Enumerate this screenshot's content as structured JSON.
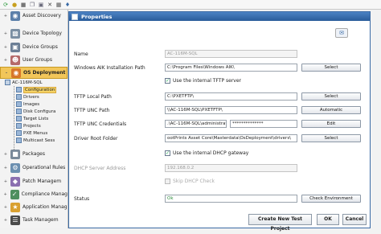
{
  "toolbar": {
    "icons": [
      "refresh-icon",
      "user-icon",
      "lock-icon",
      "copy-icon",
      "paste-icon",
      "delete-icon",
      "grid-icon",
      "share-icon"
    ]
  },
  "sidebar": {
    "items": [
      {
        "label": "Asset Discovery",
        "icon": "binoculars-icon",
        "color": "#5b7fa9"
      },
      {
        "label": "Device Topology",
        "icon": "topology-icon",
        "color": "#7b8fa3"
      },
      {
        "label": "Device Groups",
        "icon": "computers-icon",
        "color": "#6c7f96"
      },
      {
        "label": "User Groups",
        "icon": "users-icon",
        "color": "#b56a6a"
      },
      {
        "label": "OS Deployment",
        "icon": "deployment-icon",
        "color": "#d8772a"
      },
      {
        "label": "Packages",
        "icon": "package-icon",
        "color": "#7a8a9a"
      },
      {
        "label": "Operational Rules",
        "icon": "rules-icon",
        "color": "#6b8fb0"
      },
      {
        "label": "Patch Managem",
        "icon": "patch-icon",
        "color": "#8a6fb0"
      },
      {
        "label": "Compliance Manag",
        "icon": "compliance-icon",
        "color": "#4f8f5f"
      },
      {
        "label": "Application Manag",
        "icon": "application-icon",
        "color": "#d9a030"
      },
      {
        "label": "Task Managem",
        "icon": "task-icon",
        "color": "#4a4a4a"
      }
    ],
    "tree_root": "AC-116M-SQL",
    "tree_children": [
      "Configuration",
      "Drivers",
      "Images",
      "Disk Configura",
      "Target Lists",
      "Projects",
      "PXE Menus",
      "Multicast Sess"
    ]
  },
  "dialog": {
    "title": "Properties",
    "name_label": "Name",
    "name_value": "AC-116M-SQL",
    "waik_label": "Windows AIK Installation Path",
    "waik_value": "C:\\Program Files\\Windows AIK\\",
    "waik_button": "Select",
    "use_tftp_label": "Use the internal TFTP server",
    "tftp_local_label": "TFTP Local Path",
    "tftp_local_value": "C:\\PXETFTP\\",
    "tftp_local_button": "Select",
    "tftp_unc_label": "TFTP UNC Path",
    "tftp_unc_value": "\\\\AC-116M-SQL\\PXETFTP\\",
    "tftp_unc_button": "Automatic",
    "tftp_cred_label": "TFTP UNC Credentials",
    "tftp_cred_user": ".\\AC-116M-SQL\\administrator",
    "tftp_cred_password": "**************",
    "tftp_cred_button": "Edit",
    "driver_label": "Driver Root Folder",
    "driver_value": "ootPrints Asset Core\\Masterdata\\OsDeployment\\drivers\\",
    "driver_button": "Select",
    "use_dhcp_label": "Use the internal DHCP gateway",
    "dhcp_addr_label": "DHCP Server Address",
    "dhcp_addr_value": "192.168.0.2",
    "skip_dhcp_label": "Skip DHCP Check",
    "status_label": "Status",
    "status_value": "Ok",
    "check_env_button": "Check Environment",
    "create_test_button": "Create New Test Project",
    "ok_button": "OK",
    "cancel_button": "Cancel"
  }
}
